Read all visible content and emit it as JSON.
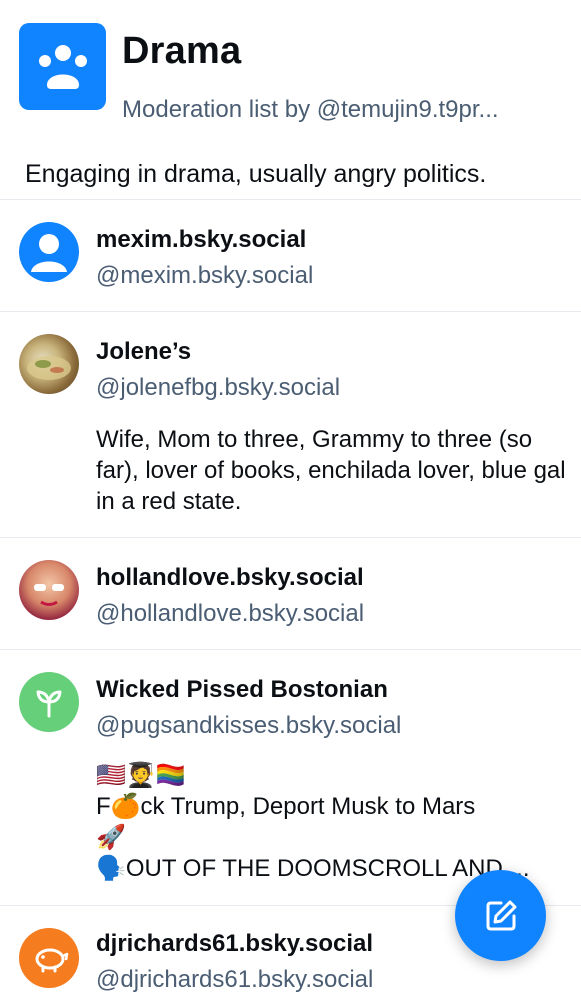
{
  "list": {
    "title": "Drama",
    "subtitle": "Moderation list by @temujin9.t9pr...",
    "description": "Engaging in drama, usually angry politics.",
    "avatar_icon": "people-group-icon",
    "accent": "#1083fe"
  },
  "members": [
    {
      "name": "mexim.bsky.social",
      "handle": "@mexim.bsky.social",
      "avatar_icon": "default-person-icon"
    },
    {
      "name": "Jolene’s",
      "handle": "@jolenefbg.bsky.social",
      "bio": "Wife, Mom to three, Grammy to three (so far), lover of books, enchilada lover, blue gal in a red state."
    },
    {
      "name": "hollandlove.bsky.social",
      "handle": "@hollandlove.bsky.social"
    },
    {
      "name": "Wicked Pissed Bostonian",
      "handle": "@pugsandkisses.bsky.social",
      "avatar_icon": "sprout-icon",
      "bio_line1": "🇺🇸🧑‍🎓🏳️‍🌈",
      "bio_line2": "F🍊ck Trump, Deport Musk to Mars",
      "bio_line3": "🚀",
      "bio_line4": "🗣️OUT OF THE DOOMSCROLL AND ..."
    },
    {
      "name": "djrichards61.bsky.social",
      "handle": "@djrichards61.bsky.social",
      "avatar_icon": "piggy-bank-icon"
    }
  ],
  "fab": {
    "icon": "compose-icon"
  }
}
